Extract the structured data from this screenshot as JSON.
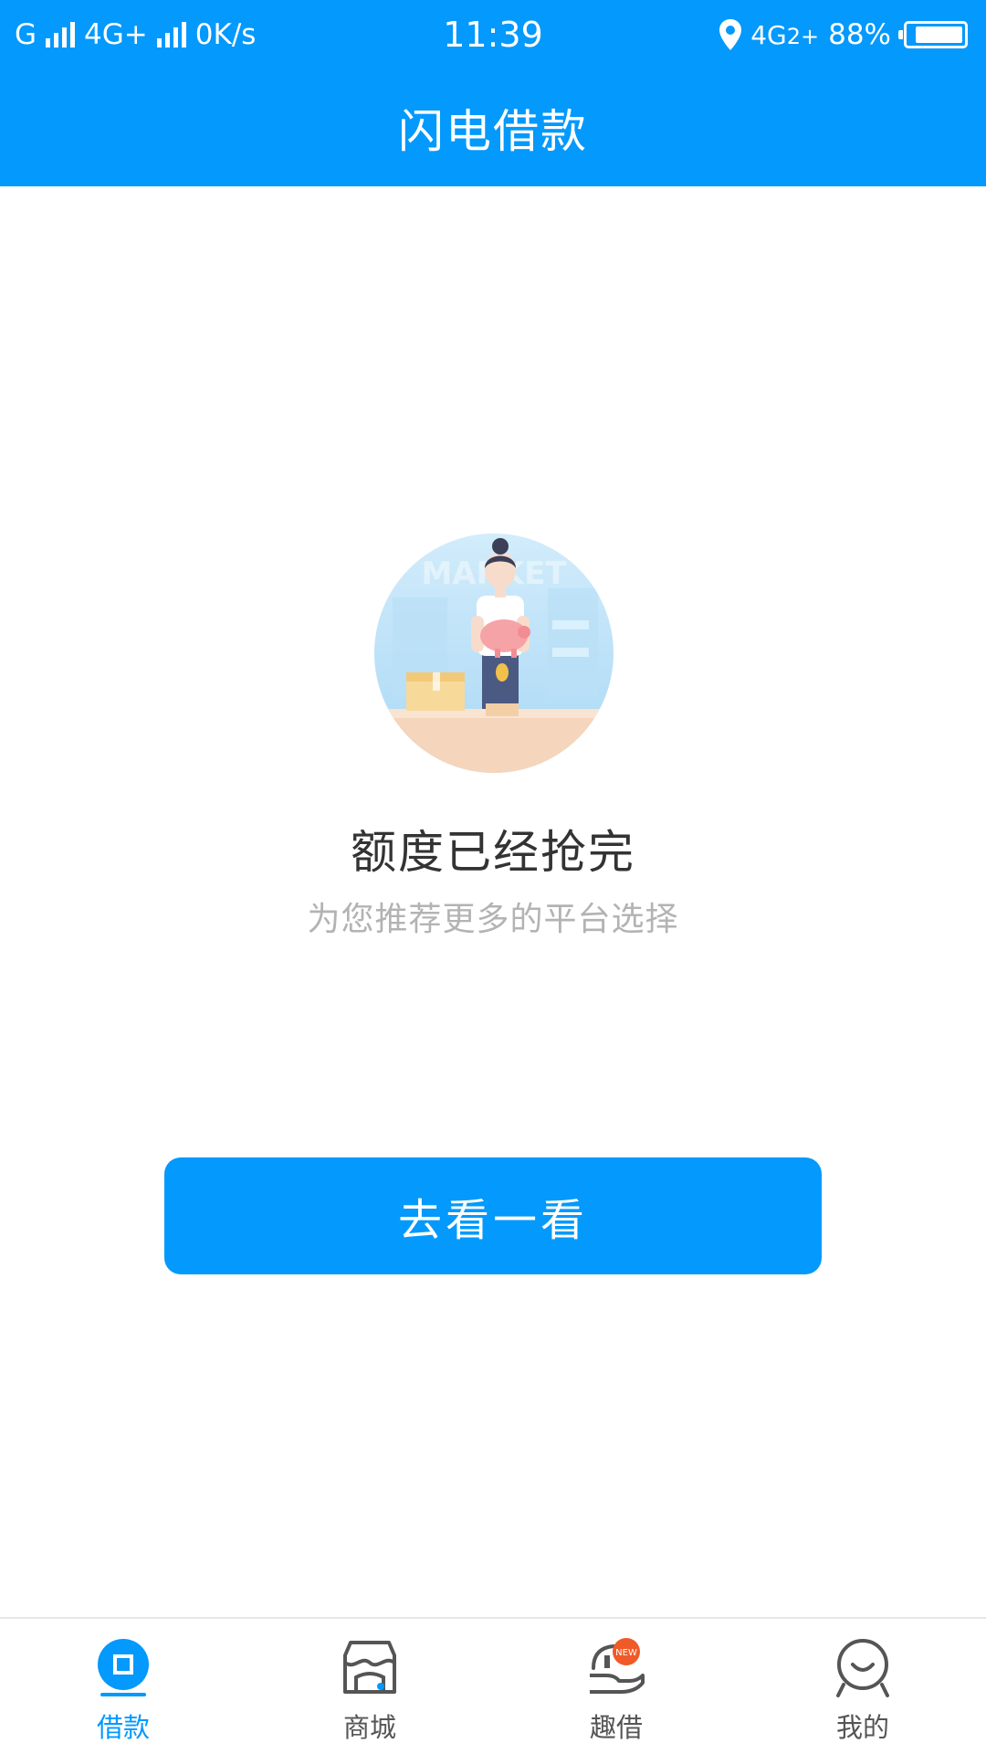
{
  "status_bar": {
    "carrier1": "G",
    "carrier2": "4G+",
    "speed": "0K/s",
    "time": "11:39",
    "network": "4G",
    "network_sub": "2+",
    "battery": "88%",
    "battery_level": 0.88
  },
  "header": {
    "title": "闪电借款"
  },
  "main": {
    "title": "额度已经抢完",
    "subtitle": "为您推荐更多的平台选择",
    "button_label": "去看一看",
    "illustration_icon": "market-woman-piggy-bank-illustration",
    "illustration_text": "MARKET"
  },
  "bottom_nav": {
    "items": [
      {
        "label": "借款",
        "icon": "loan-icon",
        "active": true
      },
      {
        "label": "商城",
        "icon": "store-icon",
        "active": false
      },
      {
        "label": "趣借",
        "icon": "hand-new-icon",
        "active": false,
        "badge": "NEW"
      },
      {
        "label": "我的",
        "icon": "profile-icon",
        "active": false
      }
    ]
  },
  "colors": {
    "primary": "#0399fd",
    "title_text": "#333333",
    "subtitle_text": "#b3b3b3",
    "nav_inactive": "#555555",
    "badge": "#f05a28"
  }
}
